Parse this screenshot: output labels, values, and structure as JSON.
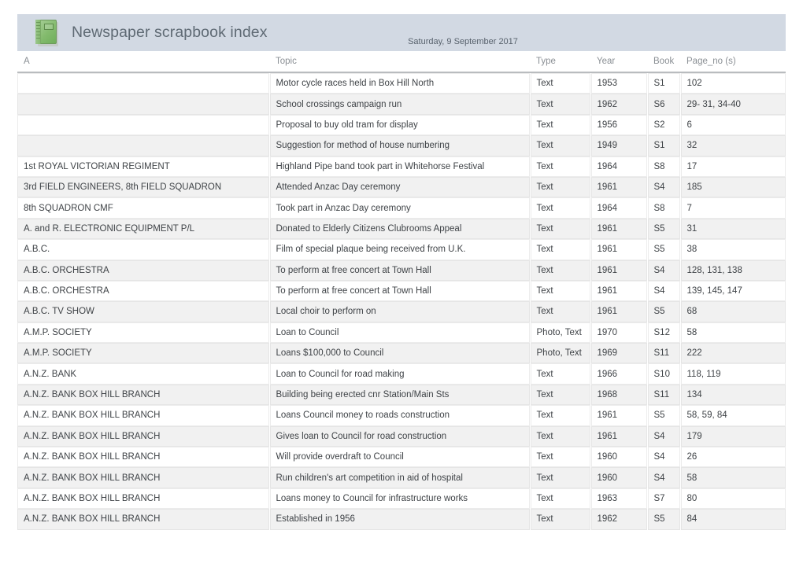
{
  "report": {
    "title": "Newspaper scrapbook index",
    "date": "Saturday, 9 September 2017",
    "icon": "scrapbook-notebook-icon",
    "header_band_color": "#d2d9e3",
    "title_color": "#5f6a74"
  },
  "table": {
    "columns": [
      {
        "key": "a",
        "label": "A"
      },
      {
        "key": "topic",
        "label": "Topic"
      },
      {
        "key": "type",
        "label": "Type"
      },
      {
        "key": "year",
        "label": "Year"
      },
      {
        "key": "book",
        "label": "Book"
      },
      {
        "key": "page_no",
        "label": "Page_no (s)"
      }
    ],
    "rows": [
      {
        "a": "",
        "topic": "Motor cycle races held in Box Hill North",
        "type": "Text",
        "year": "1953",
        "book": "S1",
        "page_no": "102"
      },
      {
        "a": "",
        "topic": "School crossings campaign run",
        "type": "Text",
        "year": "1962",
        "book": "S6",
        "page_no": "29- 31, 34-40"
      },
      {
        "a": "",
        "topic": "Proposal to buy old tram for display",
        "type": "Text",
        "year": "1956",
        "book": "S2",
        "page_no": "6"
      },
      {
        "a": "",
        "topic": "Suggestion for method of house numbering",
        "type": "Text",
        "year": "1949",
        "book": "S1",
        "page_no": "32"
      },
      {
        "a": "1st ROYAL VICTORIAN REGIMENT",
        "topic": "Highland Pipe band took part in Whitehorse Festival",
        "type": "Text",
        "year": "1964",
        "book": "S8",
        "page_no": "17"
      },
      {
        "a": "3rd FIELD ENGINEERS, 8th FIELD SQUADRON",
        "topic": "Attended Anzac Day ceremony",
        "type": "Text",
        "year": "1961",
        "book": "S4",
        "page_no": "185"
      },
      {
        "a": "8th SQUADRON CMF",
        "topic": "Took part in Anzac Day ceremony",
        "type": "Text",
        "year": "1964",
        "book": "S8",
        "page_no": "7"
      },
      {
        "a": "A. and R. ELECTRONIC EQUIPMENT P/L",
        "topic": "Donated to Elderly Citizens Clubrooms Appeal",
        "type": "Text",
        "year": "1961",
        "book": "S5",
        "page_no": "31"
      },
      {
        "a": "A.B.C.",
        "topic": "Film of special plaque being received from U.K.",
        "type": "Text",
        "year": "1961",
        "book": "S5",
        "page_no": "38"
      },
      {
        "a": "A.B.C. ORCHESTRA",
        "topic": "To perform at free concert at Town Hall",
        "type": "Text",
        "year": "1961",
        "book": "S4",
        "page_no": "128, 131, 138"
      },
      {
        "a": "A.B.C. ORCHESTRA",
        "topic": "To perform at free concert at Town Hall",
        "type": "Text",
        "year": "1961",
        "book": "S4",
        "page_no": "139, 145, 147"
      },
      {
        "a": "A.B.C. TV SHOW",
        "topic": "Local choir to perform on",
        "type": "Text",
        "year": "1961",
        "book": "S5",
        "page_no": "68"
      },
      {
        "a": "A.M.P. SOCIETY",
        "topic": "Loan to Council",
        "type": "Photo, Text",
        "year": "1970",
        "book": "S12",
        "page_no": "58"
      },
      {
        "a": "A.M.P. SOCIETY",
        "topic": "Loans $100,000 to Council",
        "type": "Photo, Text",
        "year": "1969",
        "book": "S11",
        "page_no": "222"
      },
      {
        "a": "A.N.Z. BANK",
        "topic": "Loan to Council for road making",
        "type": "Text",
        "year": "1966",
        "book": "S10",
        "page_no": "118, 119"
      },
      {
        "a": "A.N.Z. BANK BOX HILL BRANCH",
        "topic": "Building being erected cnr Station/Main Sts",
        "type": "Text",
        "year": "1968",
        "book": "S11",
        "page_no": "134"
      },
      {
        "a": "A.N.Z. BANK BOX HILL BRANCH",
        "topic": "Loans Council money to roads construction",
        "type": "Text",
        "year": "1961",
        "book": "S5",
        "page_no": "58, 59, 84"
      },
      {
        "a": "A.N.Z. BANK BOX HILL BRANCH",
        "topic": "Gives loan to Council for road construction",
        "type": "Text",
        "year": "1961",
        "book": "S4",
        "page_no": "179"
      },
      {
        "a": "A.N.Z. BANK BOX HILL BRANCH",
        "topic": "Will provide overdraft to Council",
        "type": "Text",
        "year": "1960",
        "book": "S4",
        "page_no": "26"
      },
      {
        "a": "A.N.Z. BANK BOX HILL BRANCH",
        "topic": "Run children's art competition in aid of hospital",
        "type": "Text",
        "year": "1960",
        "book": "S4",
        "page_no": "58"
      },
      {
        "a": "A.N.Z. BANK BOX HILL BRANCH",
        "topic": "Loans money to Council for infrastructure works",
        "type": "Text",
        "year": "1963",
        "book": "S7",
        "page_no": "80"
      },
      {
        "a": "A.N.Z. BANK BOX HILL BRANCH",
        "topic": "Established in 1956",
        "type": "Text",
        "year": "1962",
        "book": "S5",
        "page_no": "84"
      }
    ]
  }
}
